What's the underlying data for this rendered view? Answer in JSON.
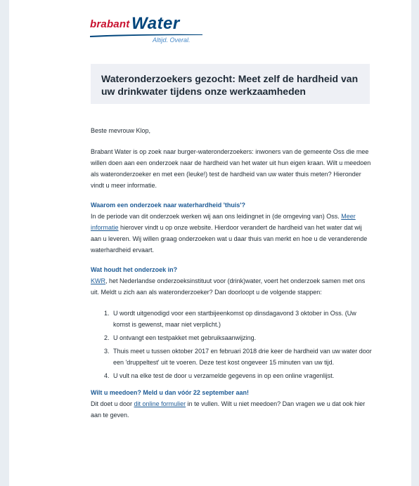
{
  "logo": {
    "brand_red": "brabant",
    "brand_blue": "Water",
    "tagline": "Altijd. Overal.",
    "colors": {
      "red": "#c8102e",
      "blue": "#00457c",
      "light_blue": "#4a8bc9"
    }
  },
  "banner": {
    "title": "Wateronderzoekers gezocht: Meet zelf de hardheid van uw drinkwater tijdens onze werkzaamheden"
  },
  "email": {
    "greeting": "Beste mevrouw Klop,",
    "intro": "Brabant Water is op zoek naar burger-wateronderzoekers: inwoners van de gemeente Oss die mee willen doen aan een onderzoek naar de hardheid van het water uit hun eigen kraan. Wilt u meedoen als wateronderzoeker en met een (leuke!) test de hardheid van uw water thuis meten? Hieronder vindt u meer informatie.",
    "section1": {
      "heading": "Waarom een onderzoek naar waterhardheid 'thuis'?",
      "text_before": "In de periode van dit onderzoek werken wij aan ons leidingnet in (de omgeving van) Oss. ",
      "link": "Meer informatie",
      "text_after": " hierover vindt u op onze website. Hierdoor verandert de hardheid van het water dat wij aan u leveren. Wij willen graag onderzoeken wat u daar thuis van merkt en hoe u de veranderende waterhardheid ervaart."
    },
    "section2": {
      "heading": "Wat houdt het onderzoek in?",
      "link": "KWR",
      "text_after": ", het Nederlandse onderzoeksinstituut voor (drink)water, voert het onderzoek samen met ons uit. Meldt u zich aan als wateronderzoeker? Dan doorloopt u de volgende stappen:",
      "steps": [
        {
          "num": "1.",
          "text": "U wordt uitgenodigd voor een startbijeenkomst op dinsdagavond 3 oktober in Oss. (Uw komst is gewenst, maar niet verplicht.)"
        },
        {
          "num": "2.",
          "text": "U ontvangt een testpakket met gebruiksaanwijzing."
        },
        {
          "num": "3.",
          "text": "Thuis meet u tussen oktober 2017 en februari 2018 drie keer de hardheid van uw water door een 'druppeltest' uit te voeren. Deze test kost ongeveer 15 minuten van uw tijd."
        },
        {
          "num": "4.",
          "text": "U vult na elke test de door u verzamelde gegevens in op een online vragenlijst."
        }
      ]
    },
    "section3": {
      "heading": "Wilt u meedoen? Meld u dan vóór 22 september aan!",
      "text_before": "Dit doet u door ",
      "link": "dit online formulier",
      "text_after": " in te vullen. Wilt u niet meedoen? Dan vragen we u dat ook hier aan te geven."
    }
  }
}
